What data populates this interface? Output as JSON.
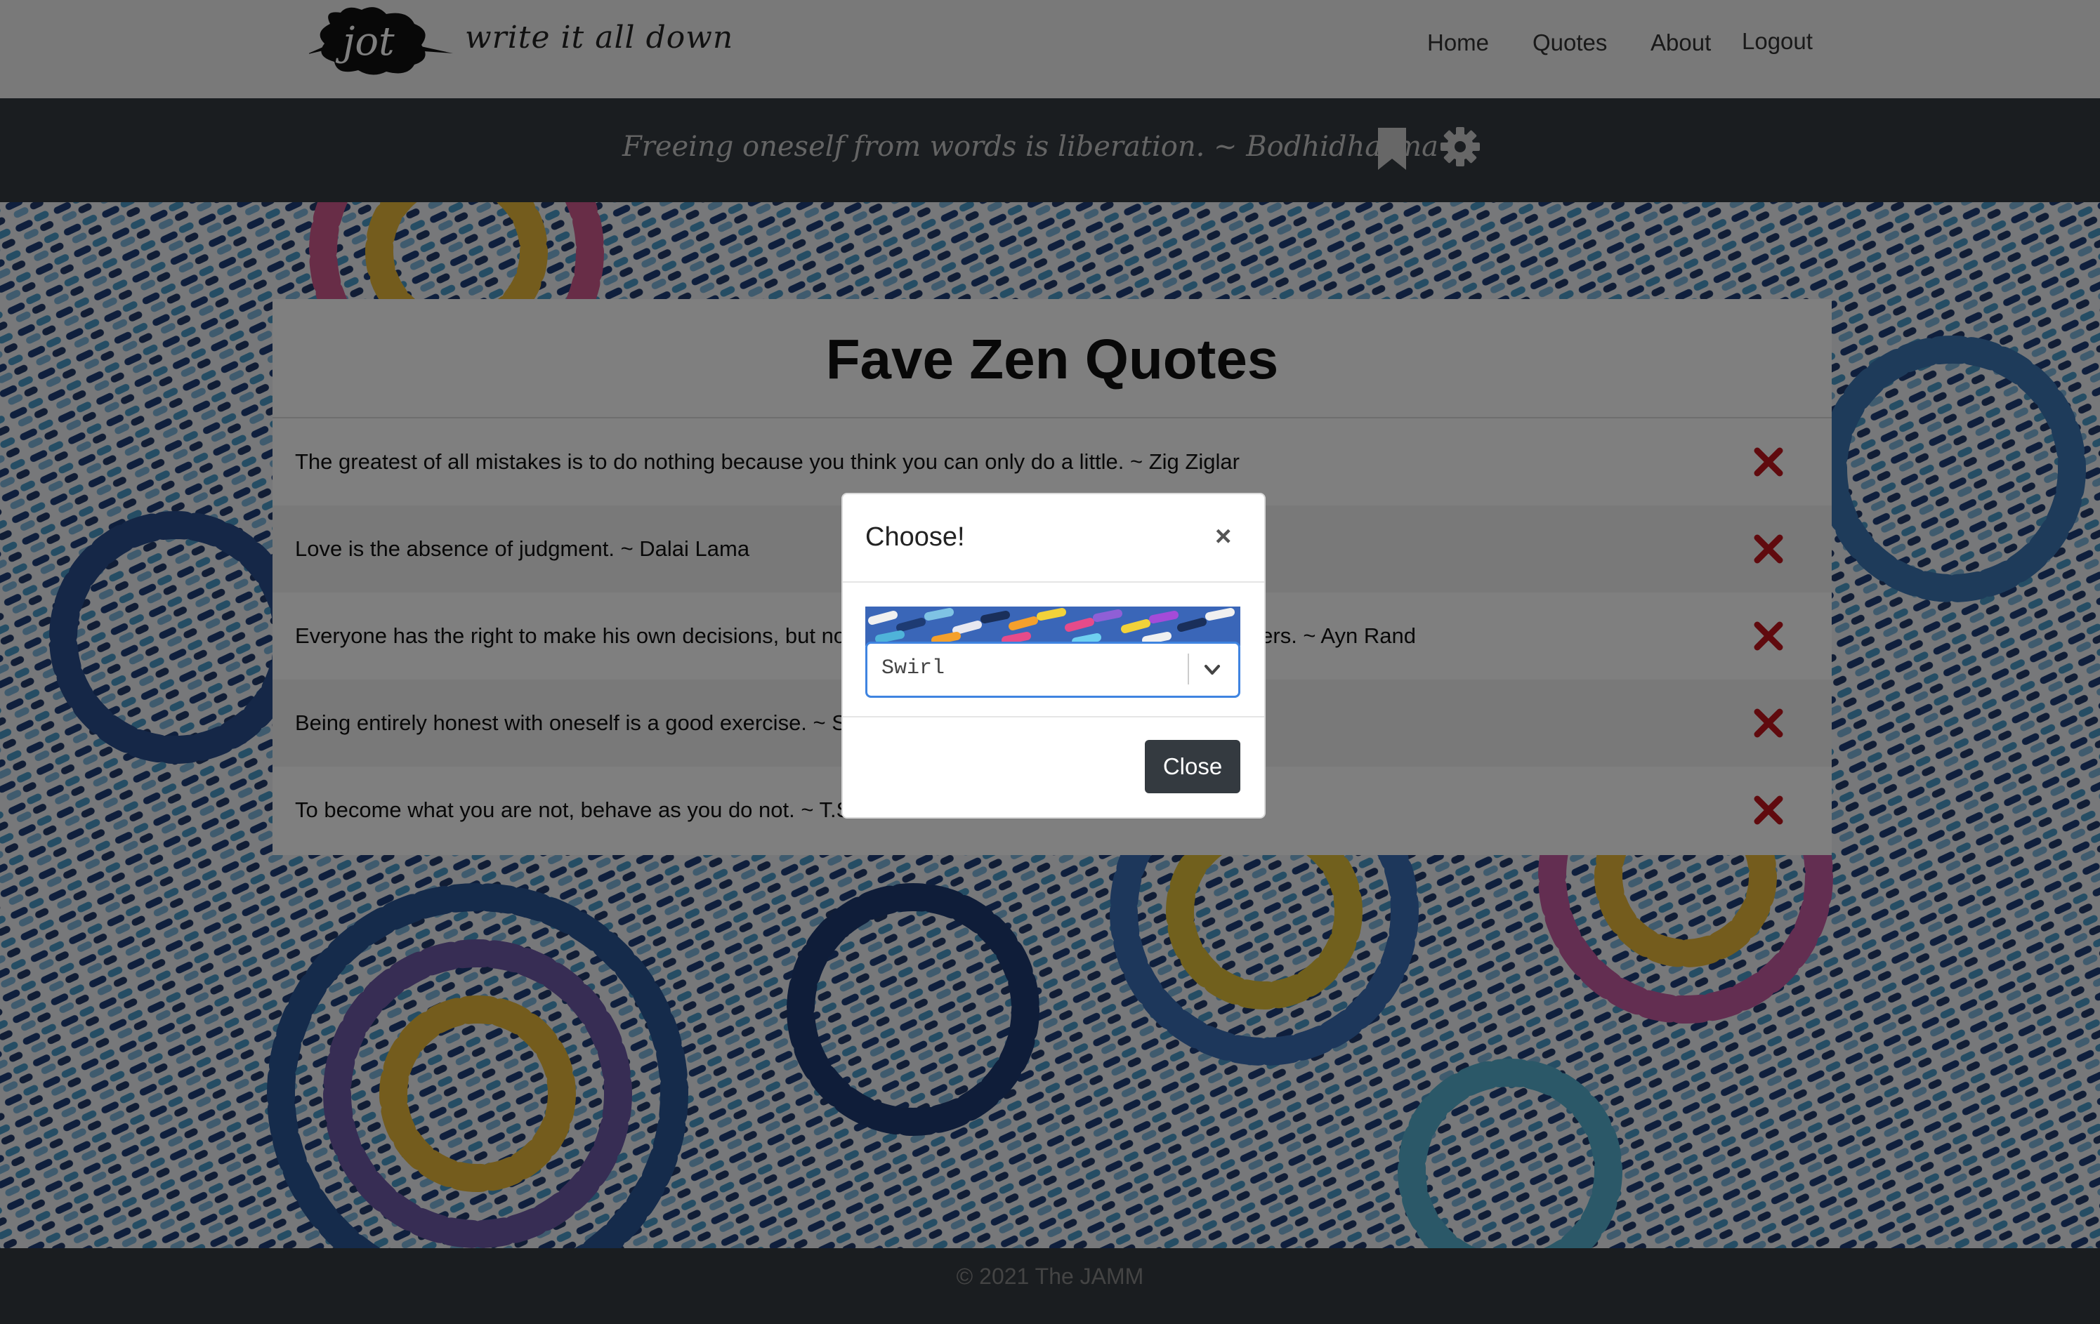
{
  "brand": {
    "logo_text": "jot",
    "tagline": "write it all down"
  },
  "nav": {
    "items": [
      "Home",
      "Quotes",
      "About",
      "Logout"
    ]
  },
  "quote_bar": {
    "text": "Freeing oneself from words is liberation. ~ Bodhidharma"
  },
  "card": {
    "title": "Fave Zen Quotes",
    "quotes": [
      "The greatest of all mistakes is to do nothing because you think you can only do a little. ~ Zig Ziglar",
      "Love is the absence of judgment. ~ Dalai Lama",
      "Everyone has the right to make his own decisions, but none has the right to force his decision on others. ~ Ayn Rand",
      "Being entirely honest with oneself is a good exercise. ~ Sigmund Freud",
      "To become what you are not, behave as you do not. ~ T.S. Eliot"
    ]
  },
  "modal": {
    "title": "Choose!",
    "close_x": "×",
    "select_value": "Swirl",
    "close_label": "Close"
  },
  "footer": {
    "text": "© 2021 The JAMM"
  },
  "colors": {
    "navbar": "#f3f3f3",
    "dark_bar": "#343a40",
    "delete_icon": "#c0141c",
    "select_border": "#3f84e0"
  }
}
